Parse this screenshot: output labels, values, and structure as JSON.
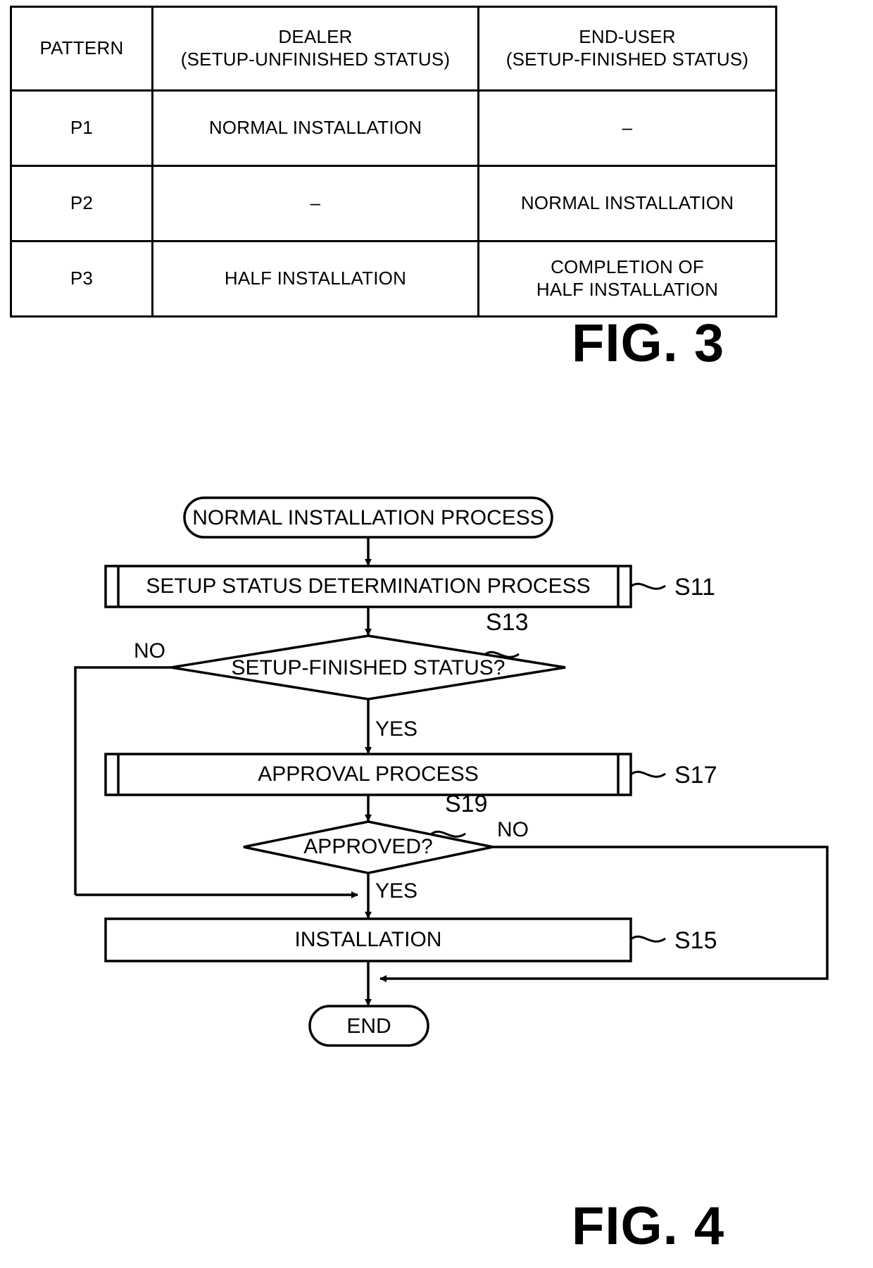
{
  "figures": {
    "fig3_label": "FIG. 3",
    "fig4_label": "FIG. 4"
  },
  "table": {
    "headers": {
      "pattern": "PATTERN",
      "dealer_line1": "DEALER",
      "dealer_line2": "(SETUP-UNFINISHED STATUS)",
      "enduser_line1": "END-USER",
      "enduser_line2": "(SETUP-FINISHED STATUS)"
    },
    "rows": [
      {
        "pattern": "P1",
        "dealer_line1": "NORMAL INSTALLATION",
        "dealer_line2": "",
        "enduser_line1": "–",
        "enduser_line2": ""
      },
      {
        "pattern": "P2",
        "dealer_line1": "–",
        "dealer_line2": "",
        "enduser_line1": "NORMAL INSTALLATION",
        "enduser_line2": ""
      },
      {
        "pattern": "P3",
        "dealer_line1": "HALF INSTALLATION",
        "dealer_line2": "",
        "enduser_line1": "COMPLETION OF",
        "enduser_line2": "HALF INSTALLATION"
      }
    ]
  },
  "flowchart": {
    "start_label": "NORMAL INSTALLATION PROCESS",
    "end_label": "END",
    "nodes": {
      "s11_text": "SETUP STATUS DETERMINATION PROCESS",
      "s11_step": "S11",
      "s13_text": "SETUP-FINISHED STATUS?",
      "s13_step": "S13",
      "s17_text": "APPROVAL PROCESS",
      "s17_step": "S17",
      "s19_text": "APPROVED?",
      "s19_step": "S19",
      "s15_text": "INSTALLATION",
      "s15_step": "S15"
    },
    "branch_labels": {
      "s13_no": "NO",
      "s13_yes": "YES",
      "s19_no": "NO",
      "s19_yes": "YES"
    }
  }
}
